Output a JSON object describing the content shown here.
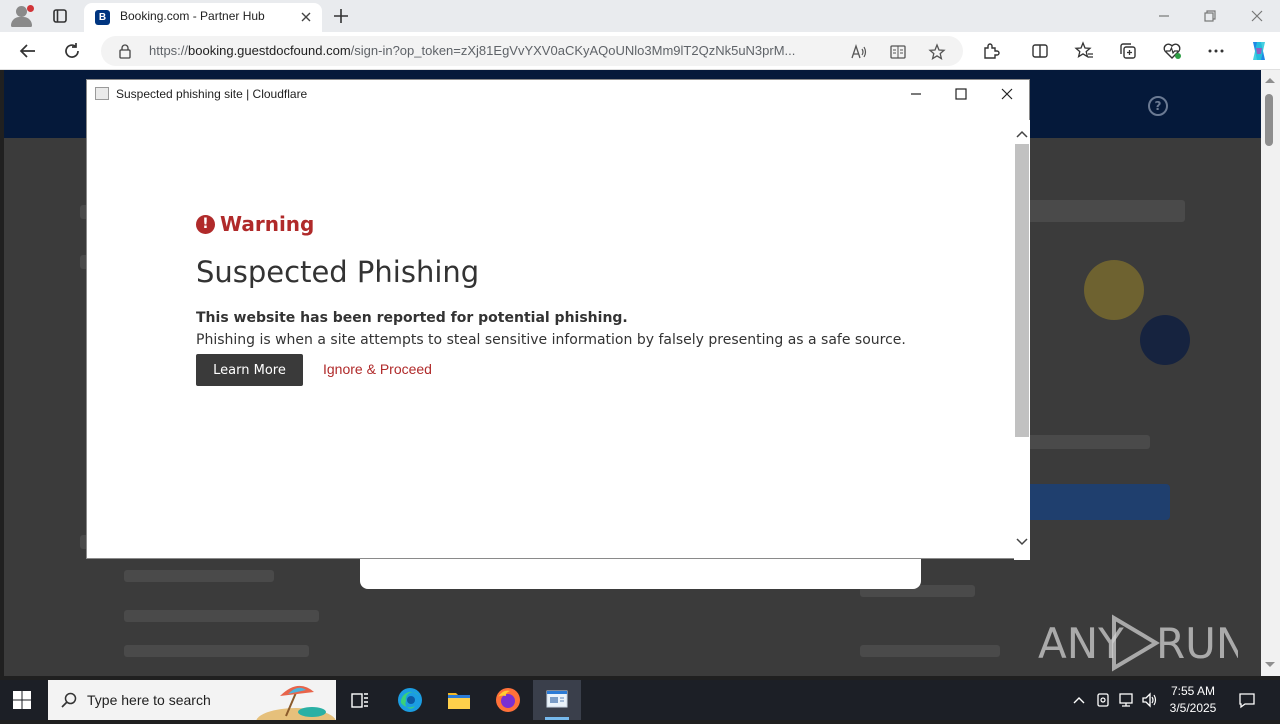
{
  "browser": {
    "tab": {
      "favicon_letter": "B",
      "title": "Booking.com - Partner Hub"
    },
    "url": {
      "prefix": "https://",
      "domain": "booking.guestdocfound.com",
      "path": "/sign-in?op_token=zXj81EgVvYXV0aCKyAQoUNlo3Mm9lT2QzNk5uN3prM..."
    },
    "icons": {
      "profile": "profile-icon",
      "tab_actions": "tab-actions-icon",
      "new_tab": "new-tab-icon",
      "back": "back-icon",
      "refresh": "refresh-icon",
      "lock": "lock-icon",
      "read_aloud": "read-aloud-icon",
      "immersive_reader": "immersive-reader-icon",
      "favorite": "star-icon",
      "extensions": "extensions-icon",
      "split_screen": "split-screen-icon",
      "favorites": "favorites-icon",
      "collections": "collections-icon",
      "browser_essentials": "heart-pulse-icon",
      "menu": "more-icon",
      "copilot": "copilot-icon"
    }
  },
  "page": {
    "help_symbol": "?"
  },
  "popup": {
    "title": "Suspected phishing site | Cloudflare",
    "warning_label": "Warning",
    "warning_symbol": "!",
    "heading": "Suspected Phishing",
    "lead": "This website has been reported for potential phishing.",
    "description": "Phishing is when a site attempts to steal sensitive information by falsely presenting as a safe source.",
    "learn_more": "Learn More",
    "ignore_proceed": "Ignore & Proceed"
  },
  "watermark": {
    "text": "ANY RUN"
  },
  "taskbar": {
    "search_placeholder": "Type here to search",
    "time": "7:55 AM",
    "date": "3/5/2025",
    "apps": [
      "task-view-icon",
      "edge-icon",
      "file-explorer-icon",
      "firefox-icon",
      "popup-window-icon"
    ]
  },
  "colors": {
    "warning_red": "#b02a2a",
    "booking_navy": "#05193a",
    "button_dark": "#3a3a3a"
  }
}
